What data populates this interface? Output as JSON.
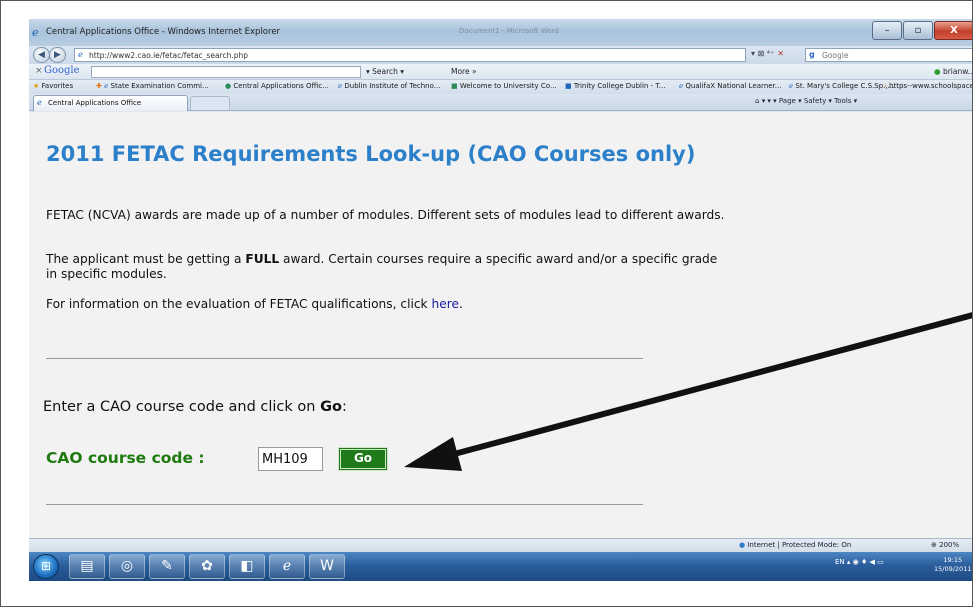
{
  "window": {
    "title": "Central Applications Office - Windows Internet Explorer",
    "background_title": "Document1 - Microsoft Word",
    "min_label": "–",
    "max_label": "▫",
    "close_label": "X"
  },
  "address": {
    "url": "http://www2.cao.ie/fetac/fetac_search.php",
    "controls": "▾ ⊠ ⁴⁺",
    "stop": "✕",
    "search_placeholder": "Google"
  },
  "google_toolbar": {
    "close": "×",
    "logo": "Google",
    "search_label": "▾  Search ▾",
    "more_label": "More »",
    "user_label": "brianw... ▾"
  },
  "favorites": [
    "Favorites",
    "State Examination Commi...",
    "Central Applications Offic...",
    "Dublin Institute of Techno...",
    "Welcome to University Co...",
    "Trinity College Dublin - T...",
    "QualifaX National Learner...",
    "St. Mary's College C.S.Sp.,...",
    "https--www.schoolspace.i..."
  ],
  "tab": {
    "label": "Central Applications Office",
    "command_bar": "▾  ▾  ▾    Page ▾   Safety ▾   Tools ▾"
  },
  "page": {
    "title": "2011 FETAC Requirements Look-up (CAO Courses only)",
    "para1": "FETAC (NCVA) awards are made up of a number of modules. Different sets of modules lead to different awards.",
    "para2_pre": "The applicant must be getting a ",
    "para2_bold": "FULL",
    "para2_post": " award. Certain courses require a specific award and/or a specific grade in specific modules.",
    "para3_pre": "For information on the evaluation of FETAC qualifications, click ",
    "para3_link": "here",
    "para3_post": ".",
    "prompt_pre": "Enter a CAO course code and click on ",
    "prompt_bold": "Go",
    "prompt_post": ":",
    "code_label": "CAO course code :",
    "code_value": "MH109",
    "go_label": "Go"
  },
  "status": {
    "zone": "Internet | Protected Mode: On",
    "zoom": "200%"
  },
  "taskbar": {
    "tray": "EN",
    "time": "19:15",
    "date": "15/09/2011"
  },
  "colors": {
    "title_blue": "#2c80c9",
    "label_green": "#1e7a0e",
    "button_green": "#1f7a1a",
    "link": "#1a1aa0"
  }
}
